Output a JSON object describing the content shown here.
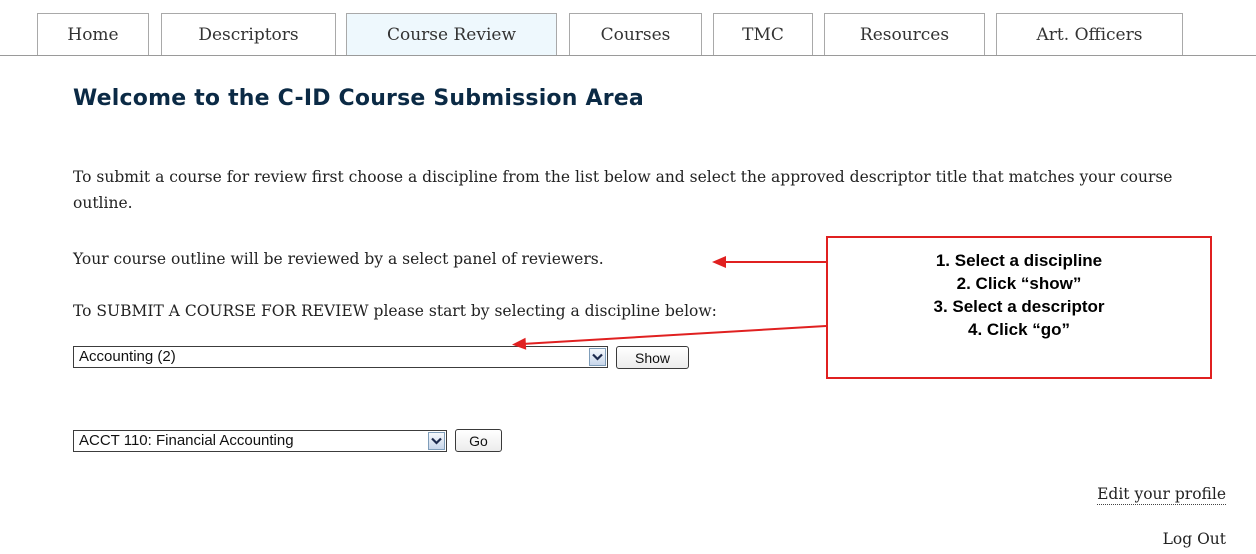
{
  "tabs": [
    {
      "label": "Home"
    },
    {
      "label": "Descriptors"
    },
    {
      "label": "Course Review"
    },
    {
      "label": "Courses"
    },
    {
      "label": "TMC"
    },
    {
      "label": "Resources"
    },
    {
      "label": "Art. Officers"
    }
  ],
  "active_tab": "Course Review",
  "page": {
    "title": "Welcome to the C-ID Course Submission Area",
    "intro": "To submit a course for review first choose a discipline from the list below and select the approved descriptor title that matches your course outline.",
    "review_note": "Your course outline will be reviewed by a select panel of reviewers.",
    "submit_prompt": "To SUBMIT A COURSE FOR REVIEW please start by selecting a discipline below:"
  },
  "discipline": {
    "selected": "Accounting (2)",
    "button_label": "Show"
  },
  "descriptor": {
    "selected": "ACCT 110: Financial Accounting",
    "button_label": "Go"
  },
  "links": {
    "edit_profile": "Edit your profile",
    "logout": "Log Out"
  },
  "callout": {
    "steps": [
      "1. Select a discipline",
      "2. Click “show”",
      "3. Select a descriptor",
      "4. Click “go”"
    ]
  },
  "colors": {
    "title": "#0b2a45",
    "active_tab_bg": "#eef8fd",
    "callout_border": "#e02020"
  },
  "icons": {
    "dropdown": "chevron-down-icon"
  }
}
